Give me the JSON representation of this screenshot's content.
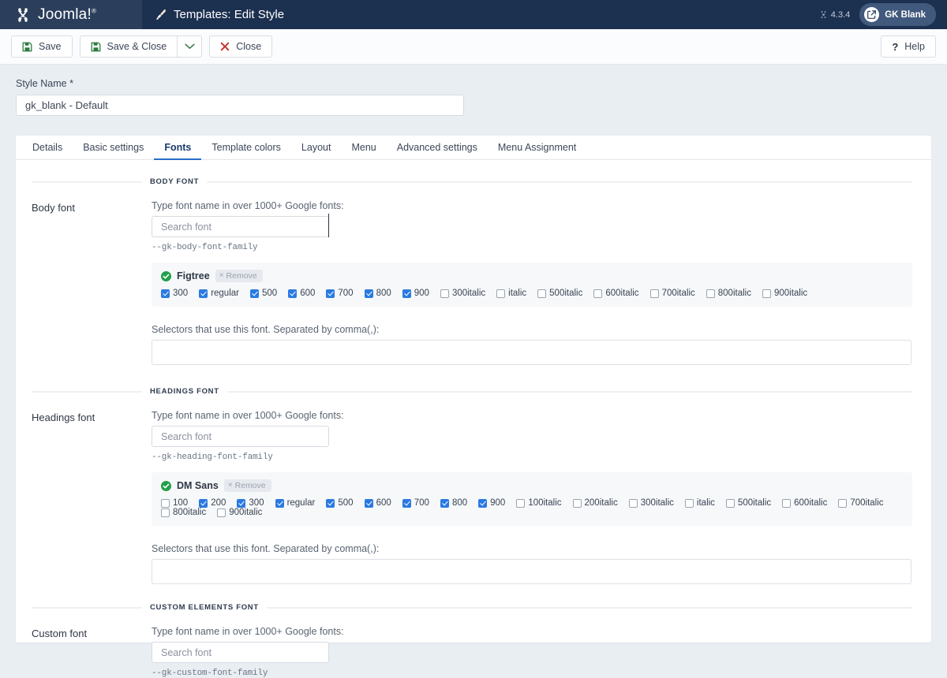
{
  "header": {
    "brand": "Joomla!",
    "title": "Templates: Edit Style",
    "version": "4.3.4",
    "site_button": "GK Blank"
  },
  "toolbar": {
    "save": "Save",
    "save_close": "Save & Close",
    "close": "Close",
    "help": "Help"
  },
  "style_name": {
    "label": "Style Name *",
    "value": "gk_blank - Default"
  },
  "tabs": [
    {
      "label": "Details",
      "active": false
    },
    {
      "label": "Basic settings",
      "active": false
    },
    {
      "label": "Fonts",
      "active": true
    },
    {
      "label": "Template colors",
      "active": false
    },
    {
      "label": "Layout",
      "active": false
    },
    {
      "label": "Menu",
      "active": false
    },
    {
      "label": "Advanced settings",
      "active": false
    },
    {
      "label": "Menu Assignment",
      "active": false
    }
  ],
  "common": {
    "search_label": "Type font name in over 1000+ Google fonts:",
    "search_placeholder": "Search font",
    "selectors_label": "Selectors that use this font. Separated by comma(,):",
    "selectors_value": "",
    "remove_label": "Remove"
  },
  "sections": [
    {
      "key": "body",
      "divider_title": "BODY FONT",
      "row_label": "Body font",
      "var_name": "--gk-body-font-family",
      "font": {
        "name": "Figtree",
        "variants": [
          {
            "label": "300",
            "checked": true
          },
          {
            "label": "regular",
            "checked": true
          },
          {
            "label": "500",
            "checked": true
          },
          {
            "label": "600",
            "checked": true
          },
          {
            "label": "700",
            "checked": true
          },
          {
            "label": "800",
            "checked": true
          },
          {
            "label": "900",
            "checked": true
          },
          {
            "label": "300italic",
            "checked": false
          },
          {
            "label": "italic",
            "checked": false
          },
          {
            "label": "500italic",
            "checked": false
          },
          {
            "label": "600italic",
            "checked": false
          },
          {
            "label": "700italic",
            "checked": false
          },
          {
            "label": "800italic",
            "checked": false
          },
          {
            "label": "900italic",
            "checked": false
          }
        ]
      },
      "has_selectors": true
    },
    {
      "key": "headings",
      "divider_title": "HEADINGS FONT",
      "row_label": "Headings font",
      "var_name": "--gk-heading-font-family",
      "font": {
        "name": "DM Sans",
        "variants": [
          {
            "label": "100",
            "checked": false
          },
          {
            "label": "200",
            "checked": true
          },
          {
            "label": "300",
            "checked": true
          },
          {
            "label": "regular",
            "checked": true
          },
          {
            "label": "500",
            "checked": true
          },
          {
            "label": "600",
            "checked": true
          },
          {
            "label": "700",
            "checked": true
          },
          {
            "label": "800",
            "checked": true
          },
          {
            "label": "900",
            "checked": true
          },
          {
            "label": "100italic",
            "checked": false
          },
          {
            "label": "200italic",
            "checked": false
          },
          {
            "label": "300italic",
            "checked": false
          },
          {
            "label": "italic",
            "checked": false
          },
          {
            "label": "500italic",
            "checked": false
          },
          {
            "label": "600italic",
            "checked": false
          },
          {
            "label": "700italic",
            "checked": false
          },
          {
            "label": "800italic",
            "checked": false
          },
          {
            "label": "900italic",
            "checked": false
          }
        ]
      },
      "has_selectors": true
    },
    {
      "key": "custom",
      "divider_title": "CUSTOM ELEMENTS FONT",
      "row_label": "Custom font",
      "var_name": "--gk-custom-font-family",
      "font": null,
      "has_selectors": false
    }
  ],
  "colors": {
    "header_bg": "#1c3050",
    "brand_bg": "#2b3f5c",
    "page_bg": "#e9eef2",
    "accent": "#2a7ae2",
    "tab_active": "#2a6fc9",
    "save_icon": "#2d7a41",
    "close_icon": "#c4352f",
    "check_circle": "#22a04a",
    "card_bg": "#f6f8fa"
  }
}
